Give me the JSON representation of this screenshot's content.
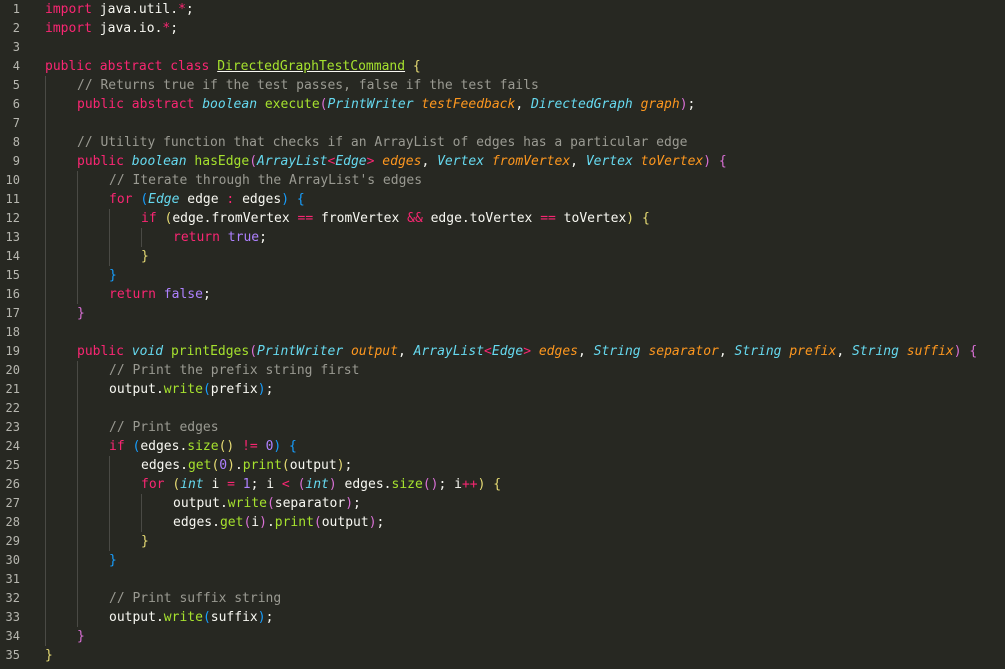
{
  "editor": {
    "language": "java",
    "theme_colors": {
      "background": "#272822",
      "keyword": "#f92672",
      "type": "#66d9ef",
      "function": "#a6e22e",
      "parameter": "#fd971f",
      "comment": "#9a9a92",
      "number": "#ae81ff",
      "text": "#f8f8f2"
    },
    "lines": [
      {
        "n": "1",
        "indent": 0,
        "tokens": [
          [
            "kw",
            "import"
          ],
          [
            "id",
            " java.util."
          ],
          [
            "op",
            "*"
          ],
          [
            "id",
            ";"
          ]
        ]
      },
      {
        "n": "2",
        "indent": 0,
        "tokens": [
          [
            "kw",
            "import"
          ],
          [
            "id",
            " java.io."
          ],
          [
            "op",
            "*"
          ],
          [
            "id",
            ";"
          ]
        ]
      },
      {
        "n": "3",
        "indent": 0,
        "tokens": []
      },
      {
        "n": "4",
        "indent": 0,
        "tokens": [
          [
            "kw",
            "public abstract class"
          ],
          [
            "id",
            " "
          ],
          [
            "class",
            "DirectedGraphTestCommand"
          ],
          [
            "id",
            " "
          ],
          [
            "brace",
            "{"
          ]
        ]
      },
      {
        "n": "5",
        "indent": 1,
        "tokens": [
          [
            "com",
            "// Returns true if the test passes, false if the test fails"
          ]
        ]
      },
      {
        "n": "6",
        "indent": 1,
        "tokens": [
          [
            "kw",
            "public abstract"
          ],
          [
            "id",
            " "
          ],
          [
            "type",
            "boolean"
          ],
          [
            "id",
            " "
          ],
          [
            "fn",
            "execute"
          ],
          [
            "brace2",
            "("
          ],
          [
            "type",
            "PrintWriter"
          ],
          [
            "id",
            " "
          ],
          [
            "param",
            "testFeedback"
          ],
          [
            "id",
            ", "
          ],
          [
            "type",
            "DirectedGraph"
          ],
          [
            "id",
            " "
          ],
          [
            "param",
            "graph"
          ],
          [
            "brace2",
            ")"
          ],
          [
            "id",
            ";"
          ]
        ]
      },
      {
        "n": "7",
        "indent": 1,
        "tokens": []
      },
      {
        "n": "8",
        "indent": 1,
        "tokens": [
          [
            "com",
            "// Utility function that checks if an ArrayList of edges has a particular edge"
          ]
        ]
      },
      {
        "n": "9",
        "indent": 1,
        "tokens": [
          [
            "kw",
            "public"
          ],
          [
            "id",
            " "
          ],
          [
            "type",
            "boolean"
          ],
          [
            "id",
            " "
          ],
          [
            "fn",
            "hasEdge"
          ],
          [
            "brace2",
            "("
          ],
          [
            "type",
            "ArrayList"
          ],
          [
            "op",
            "<"
          ],
          [
            "type",
            "Edge"
          ],
          [
            "op",
            "&gt;"
          ],
          [
            "id",
            " "
          ],
          [
            "param",
            "edges"
          ],
          [
            "id",
            ", "
          ],
          [
            "type",
            "Vertex"
          ],
          [
            "id",
            " "
          ],
          [
            "param",
            "fromVertex"
          ],
          [
            "id",
            ", "
          ],
          [
            "type",
            "Vertex"
          ],
          [
            "id",
            " "
          ],
          [
            "param",
            "toVertex"
          ],
          [
            "brace2",
            ")"
          ],
          [
            "id",
            " "
          ],
          [
            "brace2",
            "{"
          ]
        ]
      },
      {
        "n": "10",
        "indent": 2,
        "tokens": [
          [
            "com",
            "// Iterate through the ArrayList's edges"
          ]
        ]
      },
      {
        "n": "11",
        "indent": 2,
        "tokens": [
          [
            "kw",
            "for"
          ],
          [
            "id",
            " "
          ],
          [
            "brace3",
            "("
          ],
          [
            "type",
            "Edge"
          ],
          [
            "id",
            " edge "
          ],
          [
            "op",
            ":"
          ],
          [
            "id",
            " edges"
          ],
          [
            "brace3",
            ")"
          ],
          [
            "id",
            " "
          ],
          [
            "brace3",
            "{"
          ]
        ]
      },
      {
        "n": "12",
        "indent": 3,
        "tokens": [
          [
            "kw",
            "if"
          ],
          [
            "id",
            " "
          ],
          [
            "brace",
            "("
          ],
          [
            "id",
            "edge.fromVertex "
          ],
          [
            "op",
            "=="
          ],
          [
            "id",
            " fromVertex "
          ],
          [
            "op",
            "&amp;&amp;"
          ],
          [
            "id",
            " edge.toVertex "
          ],
          [
            "op",
            "=="
          ],
          [
            "id",
            " toVertex"
          ],
          [
            "brace",
            ")"
          ],
          [
            "id",
            " "
          ],
          [
            "brace",
            "{"
          ]
        ]
      },
      {
        "n": "13",
        "indent": 4,
        "tokens": [
          [
            "kw",
            "return"
          ],
          [
            "id",
            " "
          ],
          [
            "const",
            "true"
          ],
          [
            "id",
            ";"
          ]
        ]
      },
      {
        "n": "14",
        "indent": 3,
        "tokens": [
          [
            "brace",
            "}"
          ]
        ]
      },
      {
        "n": "15",
        "indent": 2,
        "tokens": [
          [
            "brace3",
            "}"
          ]
        ]
      },
      {
        "n": "16",
        "indent": 2,
        "tokens": [
          [
            "kw",
            "return"
          ],
          [
            "id",
            " "
          ],
          [
            "const",
            "false"
          ],
          [
            "id",
            ";"
          ]
        ]
      },
      {
        "n": "17",
        "indent": 1,
        "tokens": [
          [
            "brace2",
            "}"
          ]
        ]
      },
      {
        "n": "18",
        "indent": 1,
        "tokens": []
      },
      {
        "n": "19",
        "indent": 1,
        "tokens": [
          [
            "kw",
            "public"
          ],
          [
            "id",
            " "
          ],
          [
            "type",
            "void"
          ],
          [
            "id",
            " "
          ],
          [
            "fn",
            "printEdges"
          ],
          [
            "brace2",
            "("
          ],
          [
            "type",
            "PrintWriter"
          ],
          [
            "id",
            " "
          ],
          [
            "param",
            "output"
          ],
          [
            "id",
            ", "
          ],
          [
            "type",
            "ArrayList"
          ],
          [
            "op",
            "<"
          ],
          [
            "type",
            "Edge"
          ],
          [
            "op",
            "&gt;"
          ],
          [
            "id",
            " "
          ],
          [
            "param",
            "edges"
          ],
          [
            "id",
            ", "
          ],
          [
            "type",
            "String"
          ],
          [
            "id",
            " "
          ],
          [
            "param",
            "separator"
          ],
          [
            "id",
            ", "
          ],
          [
            "type",
            "String"
          ],
          [
            "id",
            " "
          ],
          [
            "param",
            "prefix"
          ],
          [
            "id",
            ", "
          ],
          [
            "type",
            "String"
          ],
          [
            "id",
            " "
          ],
          [
            "param",
            "suffix"
          ],
          [
            "brace2",
            ")"
          ],
          [
            "id",
            " "
          ],
          [
            "brace2",
            "{"
          ]
        ]
      },
      {
        "n": "20",
        "indent": 2,
        "tokens": [
          [
            "com",
            "// Print the prefix string first"
          ]
        ]
      },
      {
        "n": "21",
        "indent": 2,
        "tokens": [
          [
            "id",
            "output."
          ],
          [
            "fn",
            "write"
          ],
          [
            "brace3",
            "("
          ],
          [
            "id",
            "prefix"
          ],
          [
            "brace3",
            ")"
          ],
          [
            "id",
            ";"
          ]
        ]
      },
      {
        "n": "22",
        "indent": 2,
        "tokens": []
      },
      {
        "n": "23",
        "indent": 2,
        "tokens": [
          [
            "com",
            "// Print edges"
          ]
        ]
      },
      {
        "n": "24",
        "indent": 2,
        "tokens": [
          [
            "kw",
            "if"
          ],
          [
            "id",
            " "
          ],
          [
            "brace3",
            "("
          ],
          [
            "id",
            "edges."
          ],
          [
            "fn",
            "size"
          ],
          [
            "brace",
            "()"
          ],
          [
            "id",
            " "
          ],
          [
            "op",
            "!="
          ],
          [
            "id",
            " "
          ],
          [
            "num",
            "0"
          ],
          [
            "brace3",
            ")"
          ],
          [
            "id",
            " "
          ],
          [
            "brace3",
            "{"
          ]
        ]
      },
      {
        "n": "25",
        "indent": 3,
        "tokens": [
          [
            "id",
            "edges."
          ],
          [
            "fn",
            "get"
          ],
          [
            "brace",
            "("
          ],
          [
            "num",
            "0"
          ],
          [
            "brace",
            ")"
          ],
          [
            "id",
            "."
          ],
          [
            "fn",
            "print"
          ],
          [
            "brace",
            "("
          ],
          [
            "id",
            "output"
          ],
          [
            "brace",
            ")"
          ],
          [
            "id",
            ";"
          ]
        ]
      },
      {
        "n": "26",
        "indent": 3,
        "tokens": [
          [
            "kw",
            "for"
          ],
          [
            "id",
            " "
          ],
          [
            "brace",
            "("
          ],
          [
            "type",
            "int"
          ],
          [
            "id",
            " i "
          ],
          [
            "op",
            "="
          ],
          [
            "id",
            " "
          ],
          [
            "num",
            "1"
          ],
          [
            "id",
            "; i "
          ],
          [
            "op",
            "<"
          ],
          [
            "id",
            " "
          ],
          [
            "brace2",
            "("
          ],
          [
            "type",
            "int"
          ],
          [
            "brace2",
            ")"
          ],
          [
            "id",
            " edges."
          ],
          [
            "fn",
            "size"
          ],
          [
            "brace2",
            "()"
          ],
          [
            "id",
            "; i"
          ],
          [
            "op",
            "++"
          ],
          [
            "brace",
            ")"
          ],
          [
            "id",
            " "
          ],
          [
            "brace",
            "{"
          ]
        ]
      },
      {
        "n": "27",
        "indent": 4,
        "tokens": [
          [
            "id",
            "output."
          ],
          [
            "fn",
            "write"
          ],
          [
            "brace2",
            "("
          ],
          [
            "id",
            "separator"
          ],
          [
            "brace2",
            ")"
          ],
          [
            "id",
            ";"
          ]
        ]
      },
      {
        "n": "28",
        "indent": 4,
        "tokens": [
          [
            "id",
            "edges."
          ],
          [
            "fn",
            "get"
          ],
          [
            "brace2",
            "("
          ],
          [
            "id",
            "i"
          ],
          [
            "brace2",
            ")"
          ],
          [
            "id",
            "."
          ],
          [
            "fn",
            "print"
          ],
          [
            "brace2",
            "("
          ],
          [
            "id",
            "output"
          ],
          [
            "brace2",
            ")"
          ],
          [
            "id",
            ";"
          ]
        ]
      },
      {
        "n": "29",
        "indent": 3,
        "tokens": [
          [
            "brace",
            "}"
          ]
        ]
      },
      {
        "n": "30",
        "indent": 2,
        "tokens": [
          [
            "brace3",
            "}"
          ]
        ]
      },
      {
        "n": "31",
        "indent": 2,
        "tokens": []
      },
      {
        "n": "32",
        "indent": 2,
        "tokens": [
          [
            "com",
            "// Print suffix string"
          ]
        ]
      },
      {
        "n": "33",
        "indent": 2,
        "tokens": [
          [
            "id",
            "output."
          ],
          [
            "fn",
            "write"
          ],
          [
            "brace3",
            "("
          ],
          [
            "id",
            "suffix"
          ],
          [
            "brace3",
            ")"
          ],
          [
            "id",
            ";"
          ]
        ]
      },
      {
        "n": "34",
        "indent": 1,
        "tokens": [
          [
            "brace2",
            "}"
          ]
        ]
      },
      {
        "n": "35",
        "indent": 0,
        "tokens": [
          [
            "brace",
            "}"
          ]
        ]
      }
    ]
  }
}
